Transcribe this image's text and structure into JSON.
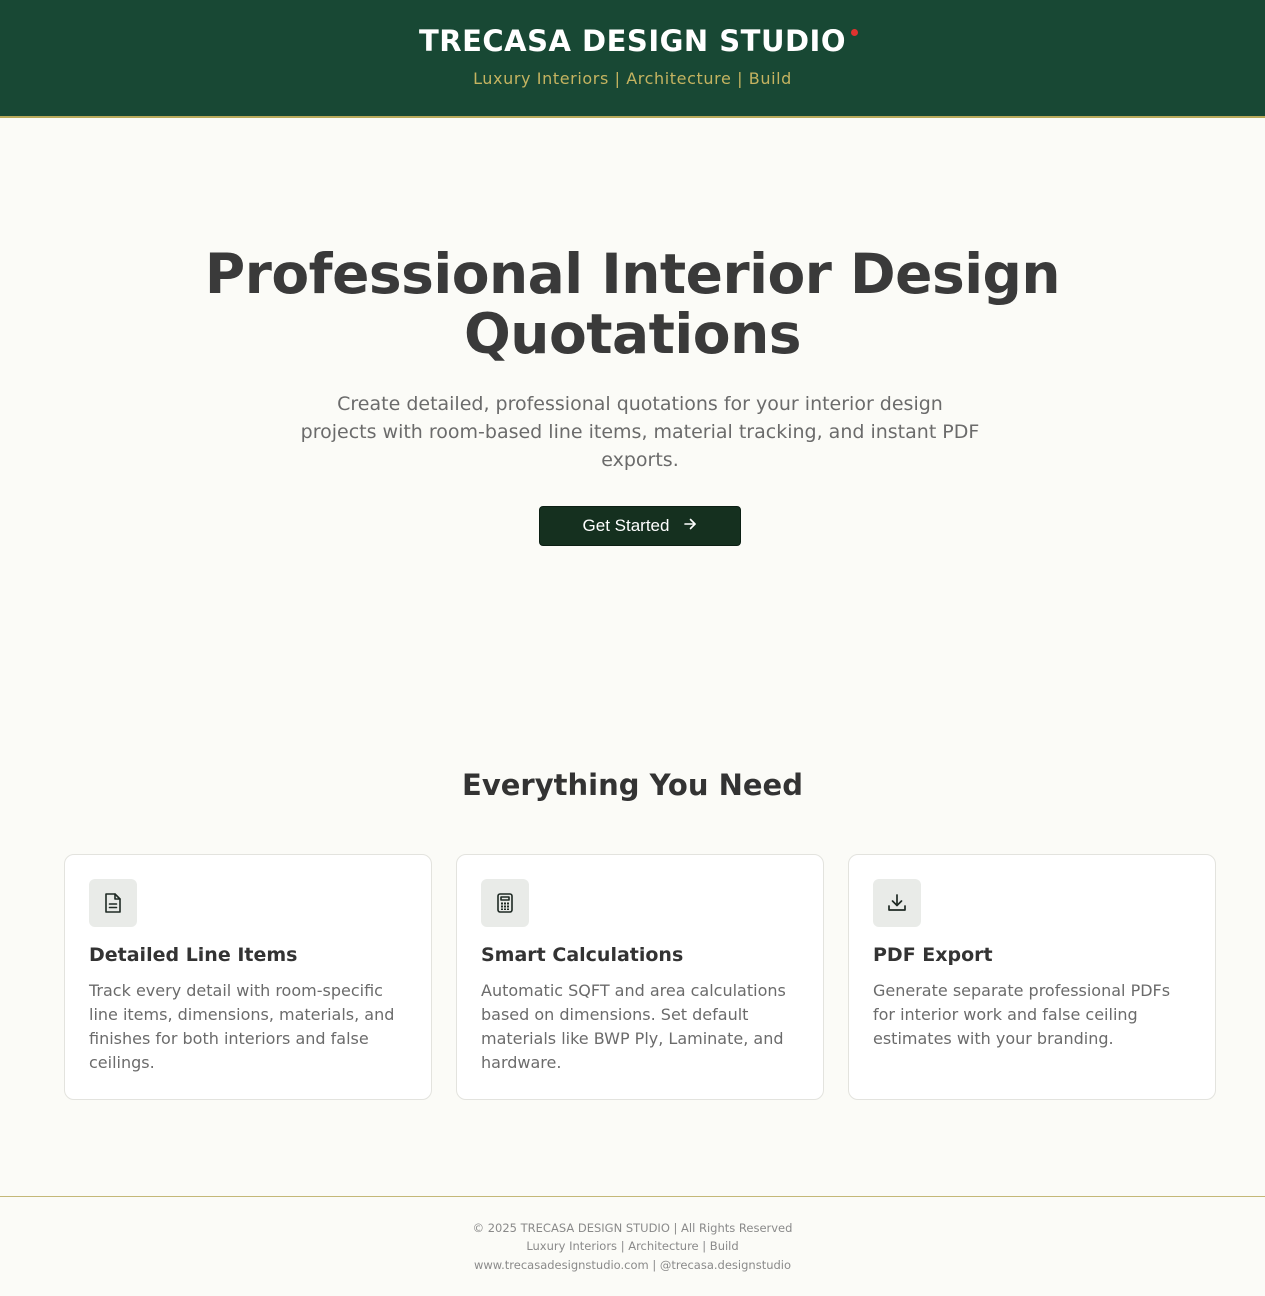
{
  "header": {
    "brand": "TRECASA DESIGN STUDIO",
    "tagline": "Luxury Interiors | Architecture | Build"
  },
  "hero": {
    "title": "Professional Interior Design Quotations",
    "subtitle": "Create detailed, professional quotations for your interior design projects with room-based line items, material tracking, and instant PDF exports.",
    "cta_label": "Get Started",
    "cta_icon": "arrow-right-icon"
  },
  "features": {
    "title": "Everything You Need",
    "cards": [
      {
        "icon": "document-icon",
        "title": "Detailed Line Items",
        "description": "Track every detail with room-specific line items, dimensions, materials, and finishes for both interiors and false ceilings."
      },
      {
        "icon": "calculator-icon",
        "title": "Smart Calculations",
        "description": "Automatic SQFT and area calculations based on dimensions. Set default materials like BWP Ply, Laminate, and hardware."
      },
      {
        "icon": "download-icon",
        "title": "PDF Export",
        "description": "Generate separate professional PDFs for interior work and false ceiling estimates with your branding."
      }
    ]
  },
  "footer": {
    "copyright": "© 2025 TRECASA DESIGN STUDIO | All Rights Reserved",
    "tagline": "Luxury Interiors | Architecture | Build",
    "links": "www.trecasadesignstudio.com | @trecasa.designstudio"
  },
  "colors": {
    "header_bg": "#184834",
    "accent_gold": "#c4b360",
    "button_bg": "#15301f",
    "page_bg": "#fbfbf7",
    "brand_dot": "#e0332f"
  }
}
